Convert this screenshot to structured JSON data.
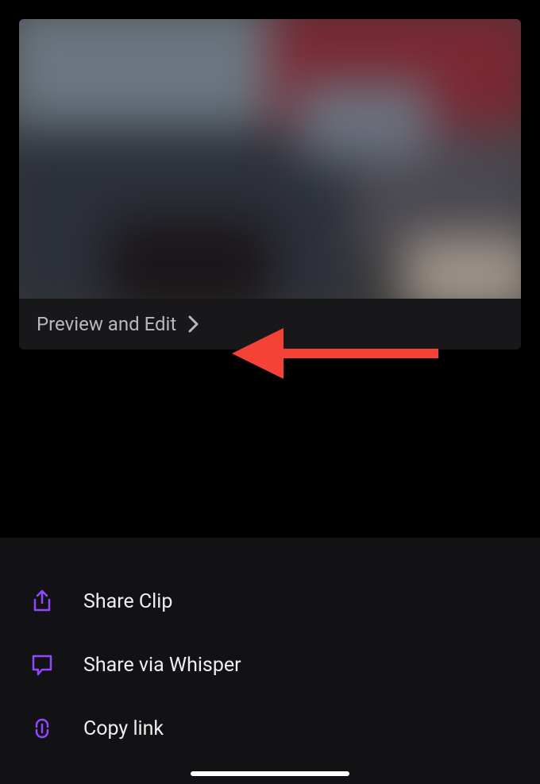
{
  "preview": {
    "label": "Preview and Edit"
  },
  "share": {
    "options": [
      {
        "label": "Share Clip",
        "icon": "share-icon"
      },
      {
        "label": "Share via Whisper",
        "icon": "chat-icon"
      },
      {
        "label": "Copy link",
        "icon": "link-icon"
      }
    ]
  },
  "colors": {
    "accent": "#9147ff",
    "annotation": "#f44336"
  }
}
